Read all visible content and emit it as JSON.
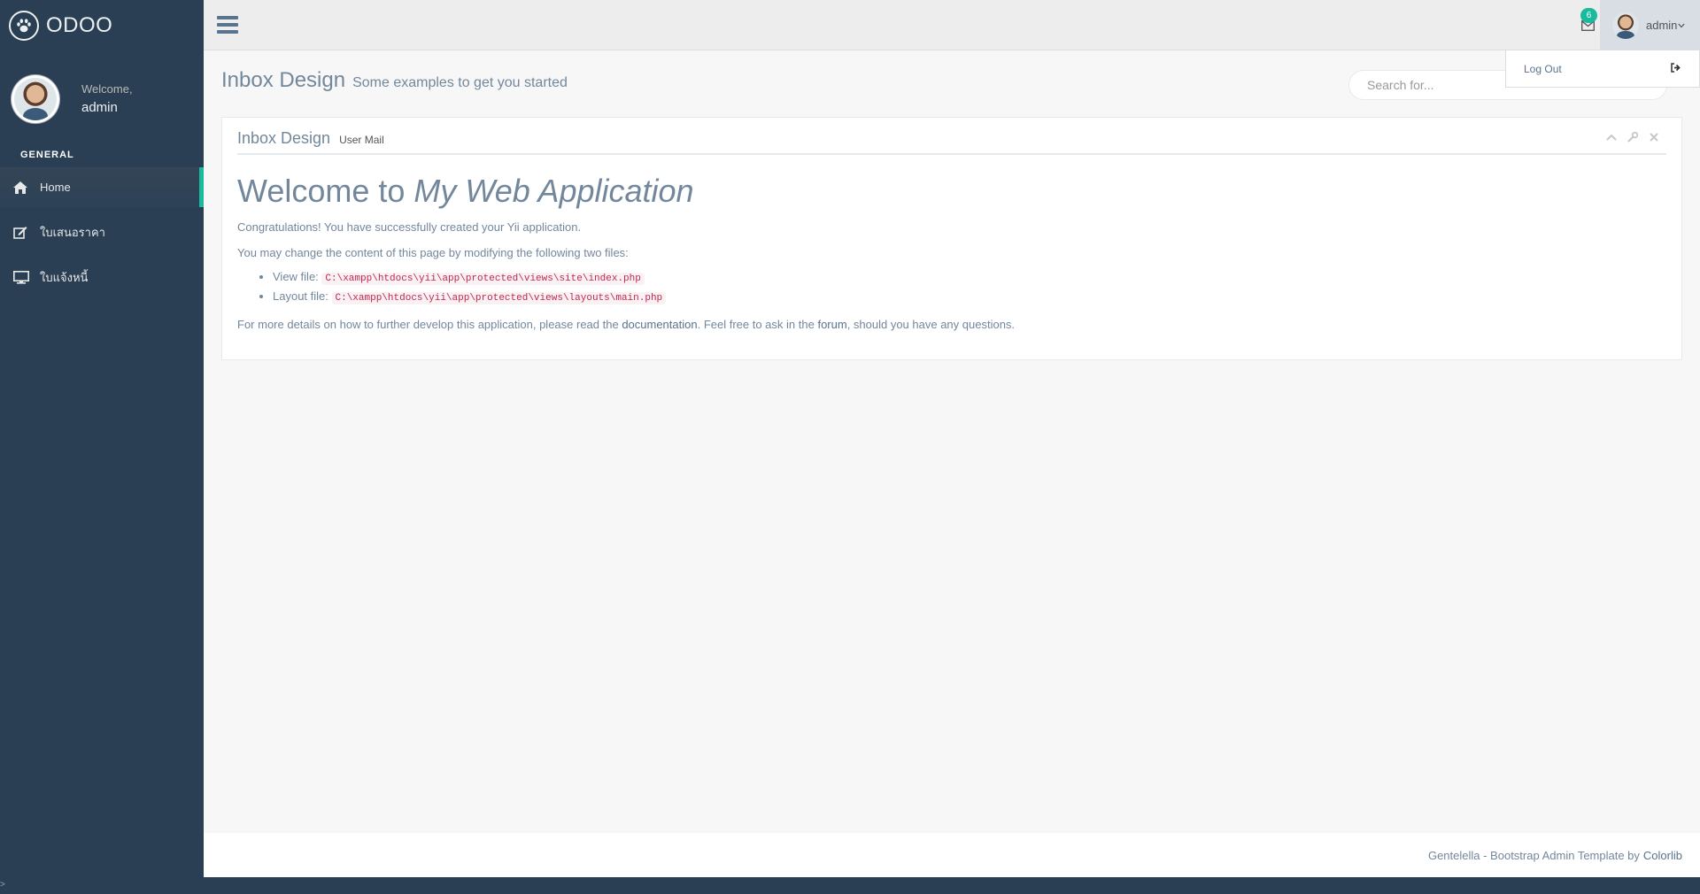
{
  "brand": {
    "name": "ODOO",
    "icon": "paw-icon"
  },
  "profile": {
    "welcome": "Welcome,",
    "username": "admin"
  },
  "sidebar": {
    "section_title": "GENERAL",
    "items": [
      {
        "label": "Home",
        "icon": "home-icon",
        "active": true
      },
      {
        "label": "ใบเสนอราคา",
        "icon": "edit-icon",
        "active": false
      },
      {
        "label": "ใบแจ้งหนี้",
        "icon": "desktop-icon",
        "active": false
      }
    ]
  },
  "topnav": {
    "mail_badge": "6",
    "user_label": "admin",
    "dropdown": {
      "logout_label": "Log Out"
    }
  },
  "page": {
    "title": "Inbox Design",
    "subtitle": "Some examples to get you started",
    "search_placeholder": "Search for..."
  },
  "panel": {
    "title": "Inbox Design",
    "subtitle": "User Mail",
    "heading_prefix": "Welcome to ",
    "heading_em": "My Web Application",
    "para1": "Congratulations! You have successfully created your Yii application.",
    "para2": "You may change the content of this page by modifying the following two files:",
    "files": [
      {
        "label": "View file: ",
        "path": "C:\\xampp\\htdocs\\yii\\app\\protected\\views\\site\\index.php"
      },
      {
        "label": "Layout file: ",
        "path": "C:\\xampp\\htdocs\\yii\\app\\protected\\views\\layouts\\main.php"
      }
    ],
    "para3_a": "For more details on how to further develop this application, please read the ",
    "link_docs": "documentation",
    "para3_b": ". Feel free to ask in the ",
    "link_forum": "forum",
    "para3_c": ", should you have any questions."
  },
  "footer": {
    "text": "Gentelella - Bootstrap Admin Template by",
    "link": "Colorlib"
  },
  "corner_glyph": ">",
  "colors": {
    "sidebar_bg": "#2A3F54",
    "accent": "#1ABB9C",
    "text": "#73879C"
  }
}
